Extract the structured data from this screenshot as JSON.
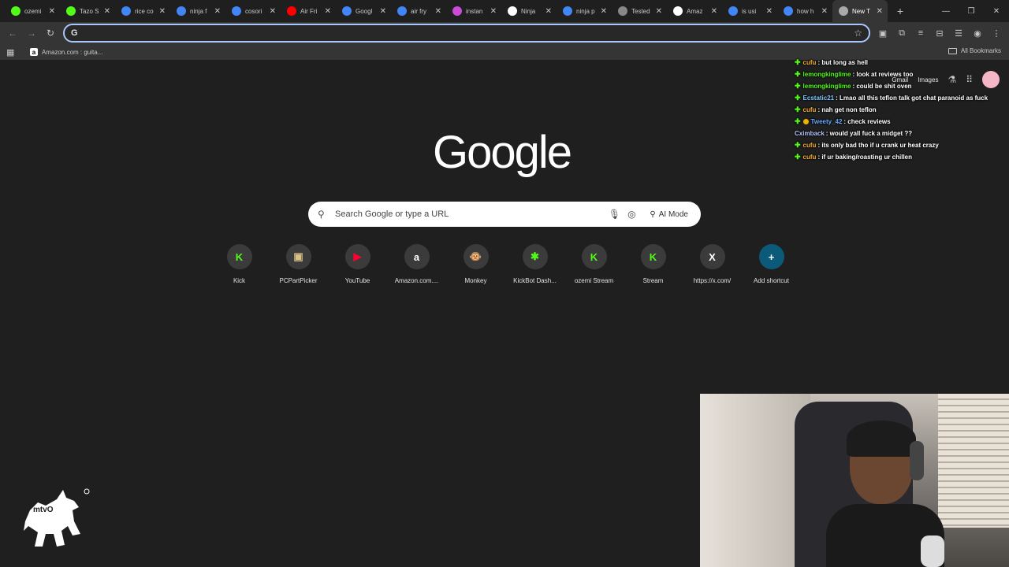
{
  "tabs": [
    {
      "title": "ozemi",
      "icon": "kick-icon",
      "color": "#53fc18"
    },
    {
      "title": "Tazo S",
      "icon": "kick-icon",
      "color": "#53fc18"
    },
    {
      "title": "rice co",
      "icon": "google-icon",
      "color": "#4285f4"
    },
    {
      "title": "ninja f",
      "icon": "google-icon",
      "color": "#4285f4"
    },
    {
      "title": "cosori",
      "icon": "google-icon",
      "color": "#4285f4"
    },
    {
      "title": "Air Fri",
      "icon": "youtube-icon",
      "color": "#ff0000"
    },
    {
      "title": "Googl",
      "icon": "google-icon",
      "color": "#4285f4"
    },
    {
      "title": "air fry",
      "icon": "google-icon",
      "color": "#4285f4"
    },
    {
      "title": "instan",
      "icon": "grid-icon",
      "color": "#c94bd6"
    },
    {
      "title": "Ninja",
      "icon": "ninja-icon",
      "color": "#ffffff"
    },
    {
      "title": "ninja p",
      "icon": "google-icon",
      "color": "#4285f4"
    },
    {
      "title": "Tested",
      "icon": "link-icon",
      "color": "#888888"
    },
    {
      "title": "Amaz",
      "icon": "amazon-icon",
      "color": "#ffffff"
    },
    {
      "title": "is usi",
      "icon": "google-icon",
      "color": "#4285f4"
    },
    {
      "title": "how h",
      "icon": "google-icon",
      "color": "#4285f4"
    },
    {
      "title": "New T",
      "icon": "chrome-icon",
      "color": "#aaaaaa",
      "active": true
    }
  ],
  "omnibox": {
    "value": "",
    "placeholder": ""
  },
  "bookmarks": {
    "items": [
      {
        "label": "Amazon.com : guita..."
      }
    ],
    "all_label": "All Bookmarks"
  },
  "ntp": {
    "logo": "Google",
    "search_placeholder": "Search Google or type a URL",
    "ai_mode": "AI Mode",
    "gmail": "Gmail",
    "images": "Images",
    "shortcuts": [
      {
        "label": "Kick",
        "glyph": "K",
        "color": "#53fc18"
      },
      {
        "label": "PCPartPicker",
        "glyph": "▣",
        "color": "#d9c089"
      },
      {
        "label": "YouTube",
        "glyph": "▶",
        "color": "#ff0033"
      },
      {
        "label": "Amazon.com....",
        "glyph": "a",
        "color": "#ffffff"
      },
      {
        "label": "Monkey",
        "glyph": "🐵",
        "color": "#d8a36b"
      },
      {
        "label": "KickBot Dash...",
        "glyph": "✱",
        "color": "#53fc18"
      },
      {
        "label": "ozemi Stream",
        "glyph": "K",
        "color": "#53fc18"
      },
      {
        "label": "Stream",
        "glyph": "K",
        "color": "#53fc18"
      },
      {
        "label": "https://x.com/",
        "glyph": "X",
        "color": "#ffffff"
      },
      {
        "label": "Add shortcut",
        "glyph": "+",
        "color": "#ffffff"
      }
    ]
  },
  "chat": [
    {
      "user": "cufu",
      "msg": ": but long as hell",
      "color": "#f7b032",
      "badge": "kick"
    },
    {
      "user": "lemongkinglime",
      "msg": ": look at reviews too",
      "color": "#53fc18",
      "badge": "kick"
    },
    {
      "user": "lemongkinglime",
      "msg": ": could be shit oven",
      "color": "#53fc18",
      "badge": "kick"
    },
    {
      "user": "Ecstatic21",
      "msg": ": Lmao all this teflon talk got chat paranoid as fuck",
      "color": "#7ec8ff",
      "badge": "kick"
    },
    {
      "user": "cufu",
      "msg": ": nah get non teflon",
      "color": "#f7b032",
      "badge": "kick"
    },
    {
      "user": "Tweety_42",
      "msg": ": check reviews",
      "color": "#6aa9ff",
      "badge": "kick-gold"
    },
    {
      "user": "Cximback",
      "msg": ": would yall fuck a midget ??",
      "color": "#b9c6ff",
      "badge": "none"
    },
    {
      "user": "cufu",
      "msg": ": its only bad tho if u crank ur heat crazy",
      "color": "#f7b032",
      "badge": "kick"
    },
    {
      "user": "cufu",
      "msg": ": if ur baking/roasting ur chillen",
      "color": "#f7b032",
      "badge": "kick"
    }
  ],
  "logo_text": "mtvO"
}
